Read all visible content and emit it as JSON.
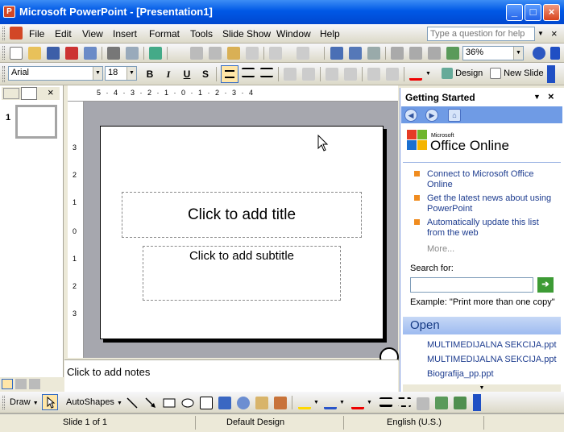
{
  "window": {
    "title": "Microsoft PowerPoint - [Presentation1]",
    "app_icon": "powerpoint-icon"
  },
  "menubar": {
    "items": [
      "File",
      "Edit",
      "View",
      "Insert",
      "Format",
      "Tools",
      "Slide Show",
      "Window",
      "Help"
    ],
    "help_box_placeholder": "Type a question for help"
  },
  "standard_toolbar": {
    "zoom": "36%"
  },
  "formatting_toolbar": {
    "font": "Arial",
    "size": "18",
    "bold": "B",
    "italic": "I",
    "underline": "U",
    "shadow": "S",
    "design_label": "Design",
    "new_slide_label": "New Slide"
  },
  "slides_pane": {
    "slide_number": "1"
  },
  "ruler": {
    "horizontal": "5 · 4 · 3 · 2 · 1 · 0 · 1 · 2 · 3 · 4",
    "vertical": [
      "3",
      "2",
      "1",
      "0",
      "1",
      "2",
      "3"
    ]
  },
  "slide": {
    "title_placeholder": "Click to add title",
    "subtitle_placeholder": "Click to add subtitle"
  },
  "notes": {
    "placeholder": "Click to add notes"
  },
  "task_pane": {
    "title": "Getting Started",
    "office_online_small": "Microsoft",
    "office_online": "Office Online",
    "links": [
      "Connect to Microsoft Office Online",
      "Get the latest news about using PowerPoint",
      "Automatically update this list from the web"
    ],
    "more": "More...",
    "search_label": "Search for:",
    "search_example": "Example:  \"Print more than one copy\"",
    "open_header": "Open",
    "open_files": [
      "MULTIMEDIJALNA SEKCIJA.ppt",
      "MULTIMEDIJALNA SEKCIJA.ppt",
      "Biografija_pp.ppt"
    ]
  },
  "drawing_toolbar": {
    "draw_label": "Draw",
    "autoshapes_label": "AutoShapes"
  },
  "statusbar": {
    "slide": "Slide 1 of 1",
    "design": "Default Design",
    "language": "English (U.S.)"
  },
  "colors": {
    "titlebar": "#0058e6",
    "accent_orange": "#f08c1f",
    "link": "#1d3c8f",
    "taskpane_nav": "#6f9be5"
  }
}
